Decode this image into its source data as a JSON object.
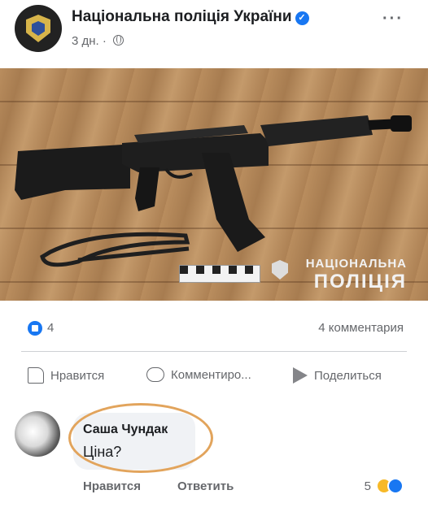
{
  "post": {
    "page_name": "Національна поліція України",
    "time": "3 дн. ·",
    "more_label": "···"
  },
  "photo": {
    "watermark_line1": "НАЦІОНАЛЬНА",
    "watermark_line2": "ПОЛІЦІЯ"
  },
  "stats": {
    "likes": "4",
    "comments": "4 комментария"
  },
  "actions": {
    "like": "Нравится",
    "comment": "Комментиро...",
    "share": "Поделиться"
  },
  "comment": {
    "author": "Саша Чундак",
    "text": "Ціна?",
    "like": "Нравится",
    "reply": "Ответить",
    "reactions": "5"
  },
  "colors": {
    "brand": "#1877f2",
    "highlight_circle": "#e2a45c"
  }
}
